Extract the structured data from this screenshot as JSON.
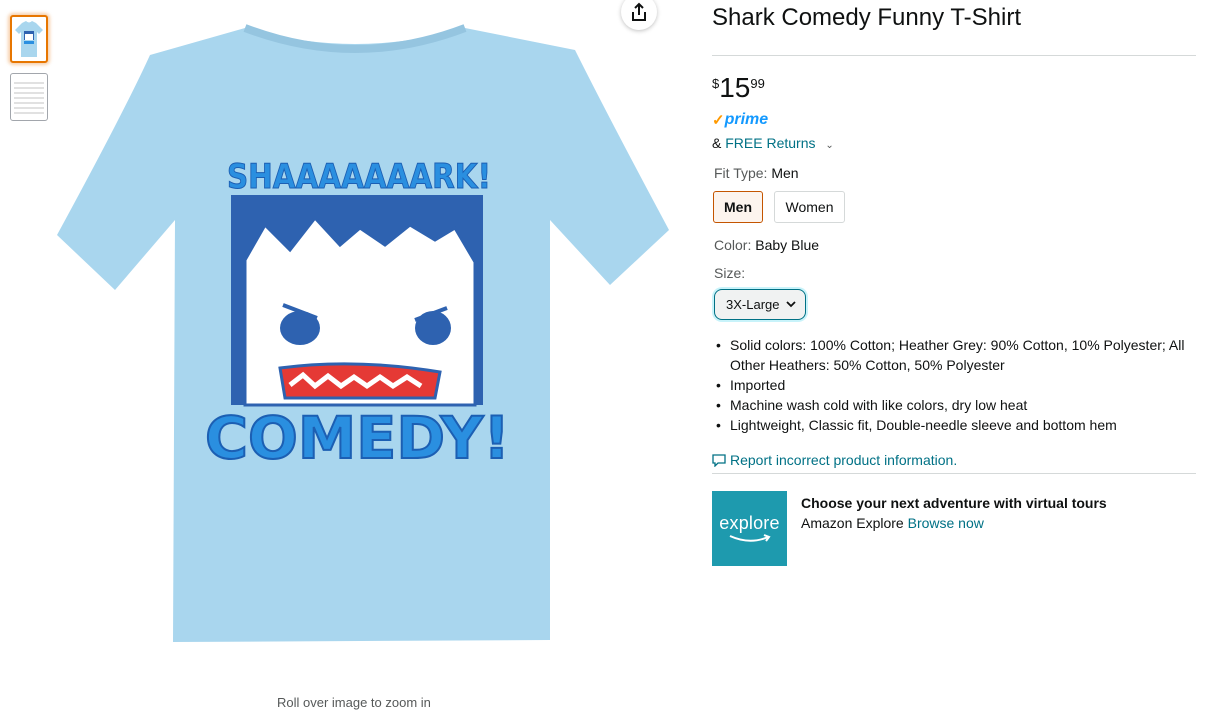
{
  "product": {
    "title": "Shark Comedy Funny T-Shirt",
    "price": {
      "currency_symbol": "$",
      "whole": "15",
      "fraction": "99"
    },
    "prime_label": "prime",
    "returns": {
      "ampersand": "&",
      "link": "FREE Returns"
    }
  },
  "fit_type": {
    "label": "Fit Type:",
    "value": "Men",
    "options": [
      "Men",
      "Women"
    ]
  },
  "color": {
    "label": "Color:",
    "value": "Baby Blue"
  },
  "size": {
    "label": "Size:",
    "selected": "3X-Large"
  },
  "bullets": [
    "Solid colors: 100% Cotton; Heather Grey: 90% Cotton, 10% Polyester; All Other Heathers: 50% Cotton, 50% Polyester",
    "Imported",
    "Machine wash cold with like colors, dry low heat",
    "Lightweight, Classic fit, Double-needle sleeve and bottom hem"
  ],
  "report_link": "Report incorrect product information.",
  "promo": {
    "logo_text": "explore",
    "headline": "Choose your next adventure with virtual tours",
    "brand": "Amazon Explore",
    "link": "Browse now"
  },
  "image": {
    "zoom_hint": "Roll over image to zoom in",
    "shirt_top_text": "SHAAAAAAARK!",
    "shirt_bottom_text": "COMEDY!"
  },
  "colors": {
    "shirt": "#A9D6EE",
    "panel": "#2E62B0",
    "text_blue": "#2A8FE0",
    "link": "#007185",
    "selected_border": "#C45500",
    "explore_bg": "#1E9AAE"
  }
}
